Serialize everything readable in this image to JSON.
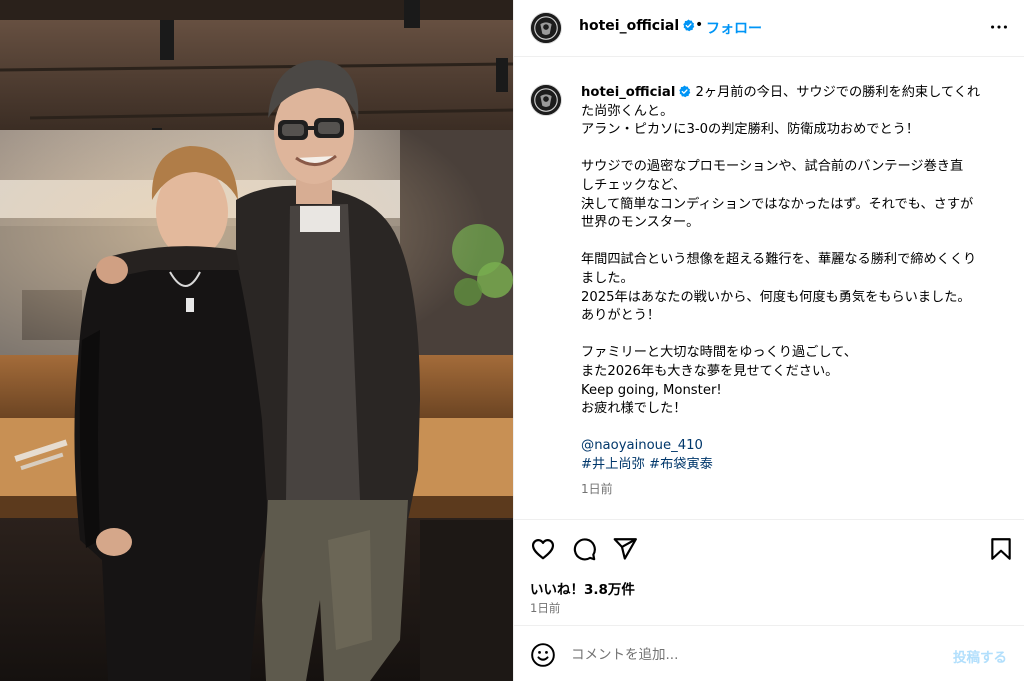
{
  "post": {
    "username": "hotei_official",
    "verified": true,
    "follow_label": "フォロー",
    "separator": "•",
    "caption_lines_1": [
      "2ヶ月前の今日、サウジでの勝利を約束してくれ",
      "た尚弥くんと。",
      "アラン・ピカソに3-0の判定勝利、防衛成功おめでとう！"
    ],
    "caption_lines_2": [
      "サウジでの過密なプロモーションや、試合前のバンテージ巻き直",
      "しチェックなど、",
      "決して簡単なコンディションではなかったはず。それでも、さすが",
      "世界のモンスター。"
    ],
    "caption_lines_3": [
      "年間四試合という想像を超える難行を、華麗なる勝利で締めくくり",
      "ました。",
      "2025年はあなたの戦いから、何度も何度も勇気をもらいました。",
      "ありがとう！"
    ],
    "caption_lines_4": [
      "ファミリーと大切な時間をゆっくり過ごして、",
      "また2026年も大きな夢を見せてください。",
      "Keep going, Monster!",
      "お疲れ様でした！"
    ],
    "mention": "@naoyainoue_410",
    "hashtag_1": "#井上尚弥",
    "hashtag_2": "#布袋寅泰",
    "caption_time": "1日前",
    "likes": "いいね！3.8万件",
    "date": "1日前"
  },
  "comment": {
    "placeholder": "コメントを追加...",
    "post_label": "投稿する"
  },
  "icons": {
    "more": "more-horizontal-icon",
    "like": "heart-icon",
    "comment": "comment-bubble-icon",
    "share": "paper-plane-icon",
    "save": "bookmark-icon",
    "emoji": "smiley-icon",
    "verified": "verified-badge-icon"
  },
  "colors": {
    "accent": "#0095f6",
    "link": "#00376b",
    "muted": "#737373",
    "post_disabled": "#b2dffc"
  }
}
